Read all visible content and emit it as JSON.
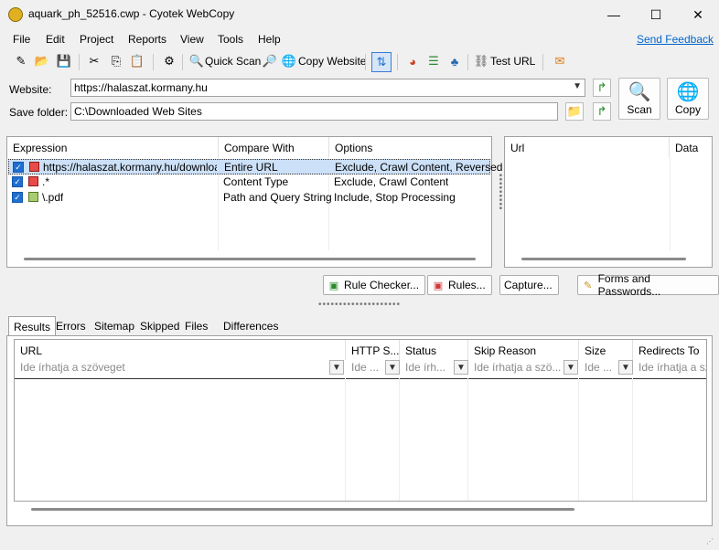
{
  "window": {
    "title": "aquark_ph_52516.cwp - Cyotek WebCopy",
    "minimize_glyph": "—",
    "maximize_glyph": "☐",
    "close_glyph": "✕"
  },
  "menu": {
    "items": [
      "File",
      "Edit",
      "Project",
      "Reports",
      "View",
      "Tools",
      "Help"
    ],
    "feedback_label": "Send Feedback"
  },
  "toolbar": {
    "quick_scan_label": "Quick Scan",
    "copy_website_label": "Copy Website",
    "test_url_label": "Test URL"
  },
  "form": {
    "website_label": "Website:",
    "website_value": "https://halaszat.kormany.hu",
    "save_folder_label": "Save folder:",
    "save_folder_value": "C:\\Downloaded Web Sites",
    "scan_label": "Scan",
    "copy_label": "Copy"
  },
  "rules": {
    "columns": [
      "Expression",
      "Compare With",
      "Options"
    ],
    "rows": [
      {
        "expression": "https://halaszat.kormany.hu/download",
        "compare": "Entire URL",
        "options": "Exclude, Crawl Content, Reversed",
        "color": "red",
        "selected": true
      },
      {
        "expression": ".*",
        "compare": "Content Type",
        "options": "Exclude, Crawl Content",
        "color": "red",
        "selected": false
      },
      {
        "expression": "\\.pdf",
        "compare": "Path and Query String",
        "options": "Include, Stop Processing",
        "color": "green",
        "selected": false
      }
    ]
  },
  "url_panel": {
    "columns": [
      "Url",
      "Data"
    ]
  },
  "actions": {
    "rule_checker": "Rule Checker...",
    "rules": "Rules...",
    "capture": "Capture...",
    "forms_passwords": "Forms and Passwords..."
  },
  "tabs": [
    "Results",
    "Errors",
    "Sitemap",
    "Skipped",
    "Files",
    "Differences"
  ],
  "results": {
    "columns": [
      {
        "label": "URL",
        "placeholder": "Ide írhatja a szöveget"
      },
      {
        "label": "HTTP S...",
        "placeholder": "Ide ..."
      },
      {
        "label": "Status",
        "placeholder": "Ide írh..."
      },
      {
        "label": "Skip Reason",
        "placeholder": "Ide írhatja a szö..."
      },
      {
        "label": "Size",
        "placeholder": "Ide ..."
      },
      {
        "label": "Redirects To",
        "placeholder": "Ide írhatja a sz"
      }
    ]
  },
  "colors": {
    "accent": "#1f6fd0",
    "link": "#0066cc",
    "selection": "#cce0f7"
  }
}
